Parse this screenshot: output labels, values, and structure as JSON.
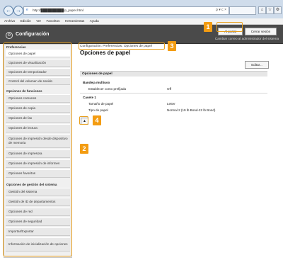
{
  "browser": {
    "url": "http://██████████/p_paper.html",
    "address_controls": "ρ ▾ c ×",
    "tab_label": "",
    "menu": [
      "Archivo",
      "Edición",
      "Ver",
      "Favoritos",
      "Herramientas",
      "Ayuda"
    ]
  },
  "header": {
    "title": "Configuración",
    "portal_label": "Al portal",
    "logout_label": "Cerrar sesión",
    "admin_note": "Cambiar correo al administrador del sistema"
  },
  "sidebar": {
    "sections": [
      {
        "title": "Preferencias",
        "items": [
          "Opciones de papel",
          "Opciones de visualización",
          "Opciones de temporizador",
          "Control del volumen de sonido"
        ]
      },
      {
        "title": "Opciones de funciones",
        "items": [
          "Opciones comunes",
          "Opciones de copia",
          "Opciones de fax",
          "Opciones de lectura",
          "Opciones de impresión desde dispositivo de memoria",
          "Opciones de impresora",
          "Opciones de impresión de informes",
          "Opciones favoritos"
        ]
      },
      {
        "title": "Opciones de gestión del sistema",
        "items": [
          "Gestión del sistema",
          "Gestión de ID de departamentos",
          "Opciones de red",
          "Opciones de seguridad",
          "Importar/Exportar",
          "Información de inicialización de opciones"
        ]
      }
    ]
  },
  "main": {
    "breadcrumb": "Configuración: Preferencias: Opciones de papel",
    "page_title": "Opciones de papel",
    "edit_label": "Editar...",
    "section_title": "Opciones de papel",
    "multi_tray": {
      "title": "Bandeja multiuso",
      "rows": [
        {
          "label": "Establecer como prefijada",
          "value": "Off"
        }
      ]
    },
    "drawer1": {
      "title": "Casete 1",
      "rows": [
        {
          "label": "Tamaño de papel",
          "value": "Letter"
        },
        {
          "label": "Tipo de papel",
          "value": "Normal 2 (19 lb Bond-22 lb Bond)"
        }
      ]
    },
    "top_icon": "▲"
  },
  "callouts": [
    "1",
    "2",
    "3",
    "4"
  ],
  "colors": {
    "callout": "#f39c12",
    "header": "#4a4a4a",
    "sidebar": "#f0f0f0",
    "accent": "#e8a020"
  }
}
